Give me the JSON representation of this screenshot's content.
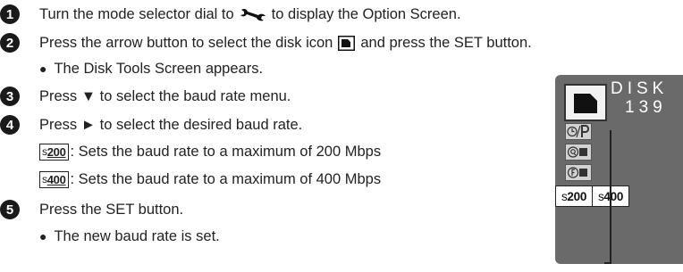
{
  "steps": [
    {
      "num": "1",
      "text_before": "Turn the mode selector dial to",
      "icon": "wrench-icon",
      "text_after": "to display the Option Screen."
    },
    {
      "num": "2",
      "text_before": "Press the arrow button to select the disk icon",
      "icon": "disk-icon",
      "text_after": "and press the SET button.",
      "note": "The Disk Tools Screen appears."
    },
    {
      "num": "3",
      "text": "Press ▼ to select the baud rate menu."
    },
    {
      "num": "4",
      "text": "Press ► to select the desired baud rate.",
      "options": [
        {
          "badge_s": "s",
          "badge_num": "200",
          "desc": ": Sets the baud rate to a maximum of 200 Mbps"
        },
        {
          "badge_s": "s",
          "badge_num": "400",
          "desc": ": Sets the baud rate to a maximum of 400 Mbps"
        }
      ]
    },
    {
      "num": "5",
      "text": "Press the SET button.",
      "note": "The new baud rate is set."
    }
  ],
  "bullet": "●",
  "lcd": {
    "header": "DISK",
    "number": "139",
    "icons": [
      "timer-p-icon",
      "option-q-icon",
      "option-f-icon"
    ],
    "options": [
      {
        "s": "s",
        "num": "200"
      },
      {
        "s": "s",
        "num": "400"
      }
    ],
    "colors": {
      "screen": "#6a6a6a",
      "text": "#ffffff"
    }
  }
}
